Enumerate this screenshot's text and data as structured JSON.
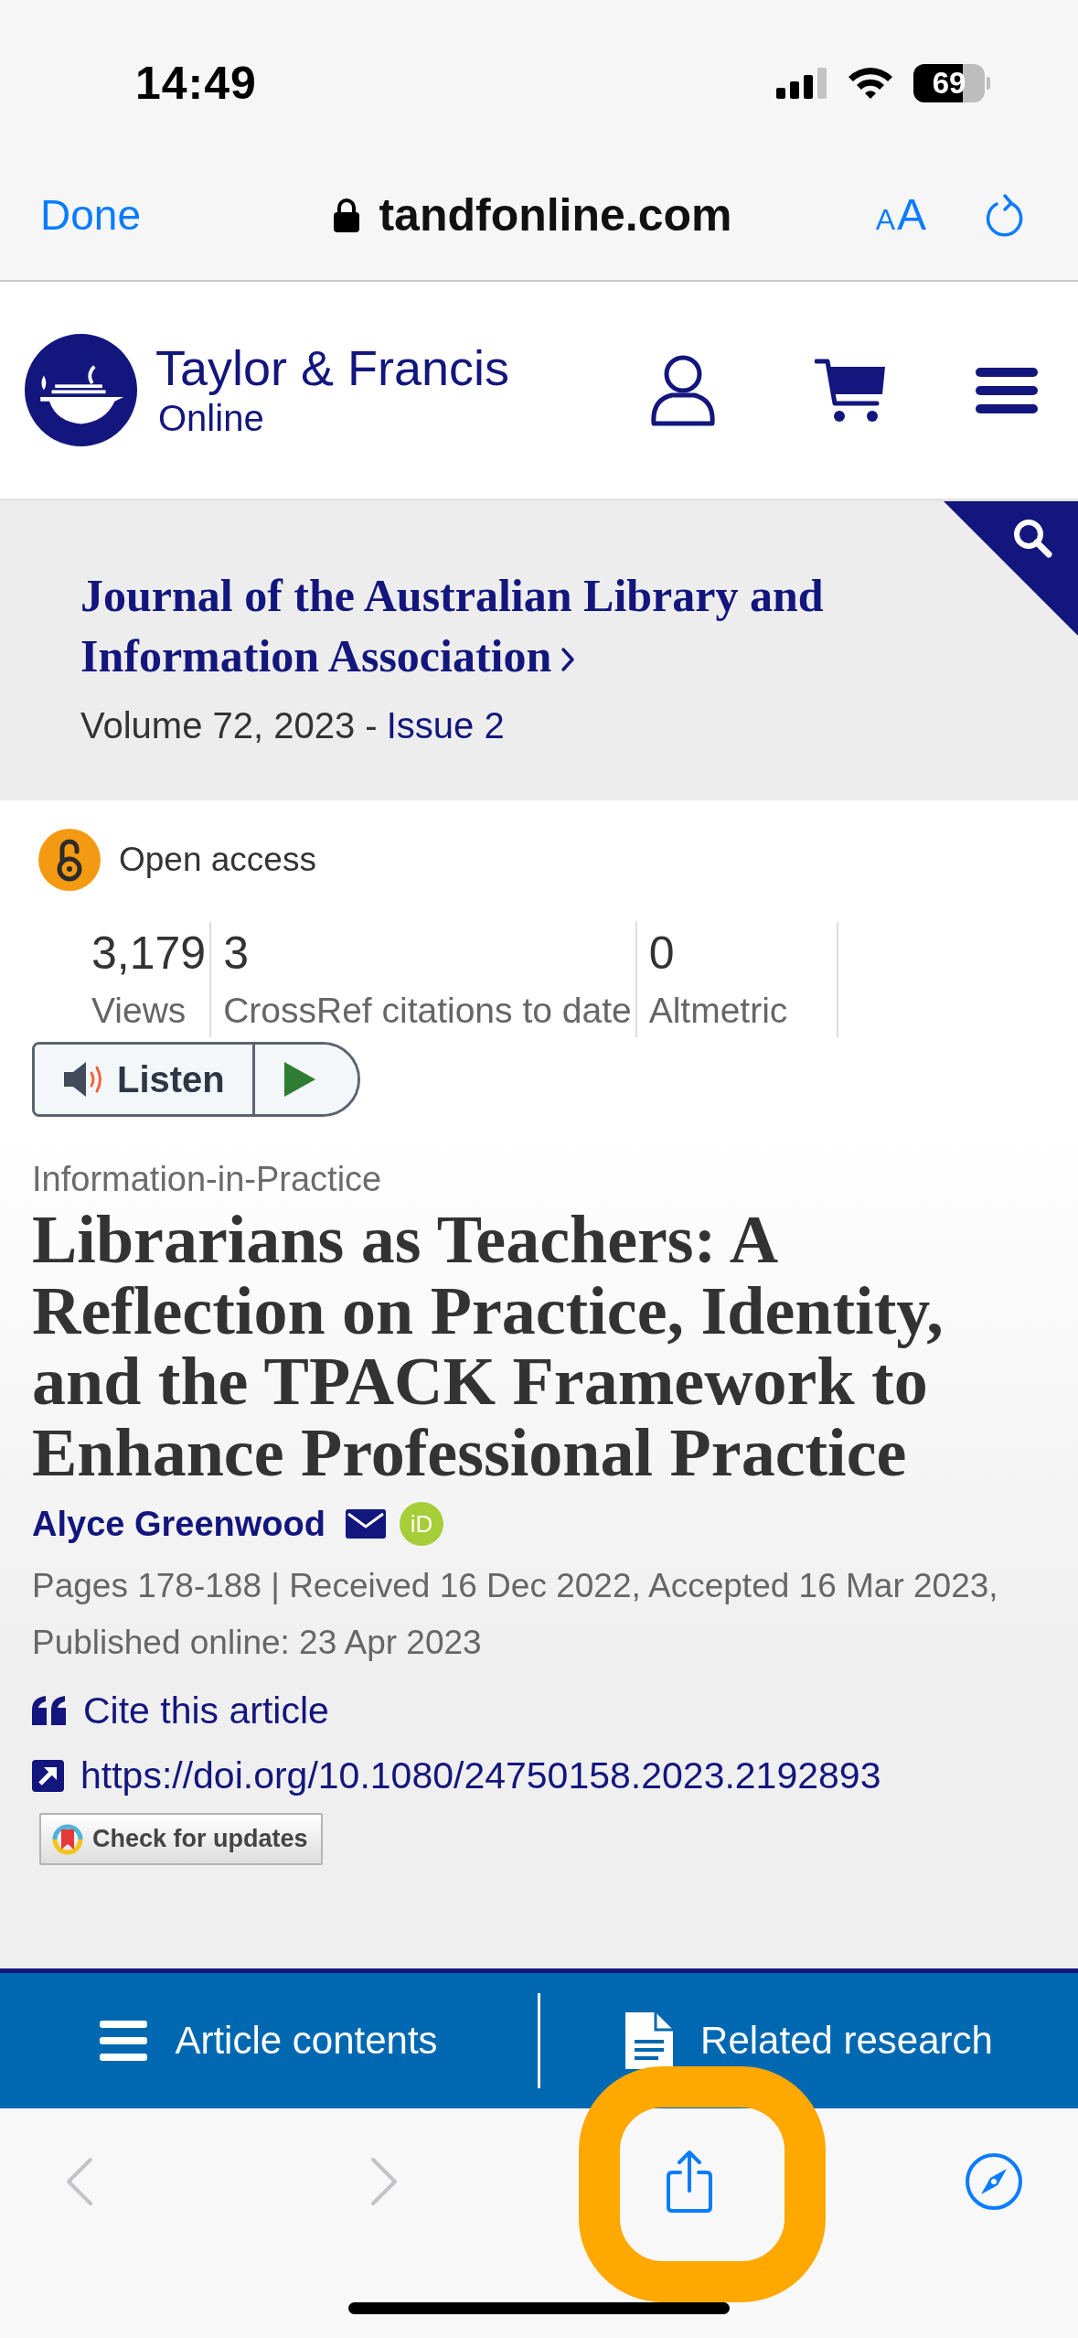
{
  "status_bar": {
    "time": "14:49",
    "battery": "69"
  },
  "browser_bar": {
    "done": "Done",
    "domain": "tandfonline.com",
    "text_size": {
      "small": "A",
      "large": "A"
    }
  },
  "site_header": {
    "brand": "Taylor & Francis",
    "brand_sub": "Online"
  },
  "journal_banner": {
    "journal": "Journal of the Australian Library and Information Association",
    "volume": "Volume 72, 2023 -",
    "issue": "Issue 2"
  },
  "article": {
    "access": "Open access",
    "metrics": [
      {
        "value": "3,179",
        "label": "Views"
      },
      {
        "value": "3",
        "label": "CrossRef citations to date"
      },
      {
        "value": "0",
        "label": "Altmetric"
      }
    ],
    "listen": "Listen",
    "section": "Information-in-Practice",
    "title": "Librarians as Teachers: A Reflection on Practice, Identity, and the TPACK Framework to Enhance Professional Practice",
    "author": {
      "name": "Alyce Greenwood",
      "orcid": "iD"
    },
    "dates": "Pages 178-188 | Received 16 Dec 2022, Accepted 16 Mar 2023, Published online: 23 Apr 2023",
    "cite": "Cite this article",
    "doi": "https://doi.org/10.1080/24750158.2023.2192893",
    "updates": "Check for updates"
  },
  "article_nav": [
    {
      "kind": "contents",
      "label": "Article contents"
    },
    {
      "kind": "related",
      "label": "Related research"
    }
  ],
  "toolbar": {
    "items": [
      {
        "kind": "back",
        "disabled": true,
        "highlighted": false
      },
      {
        "kind": "forward",
        "disabled": true,
        "highlighted": false
      },
      {
        "kind": "share",
        "disabled": false,
        "highlighted": true
      },
      {
        "kind": "compass",
        "disabled": false,
        "highlighted": false
      }
    ]
  }
}
